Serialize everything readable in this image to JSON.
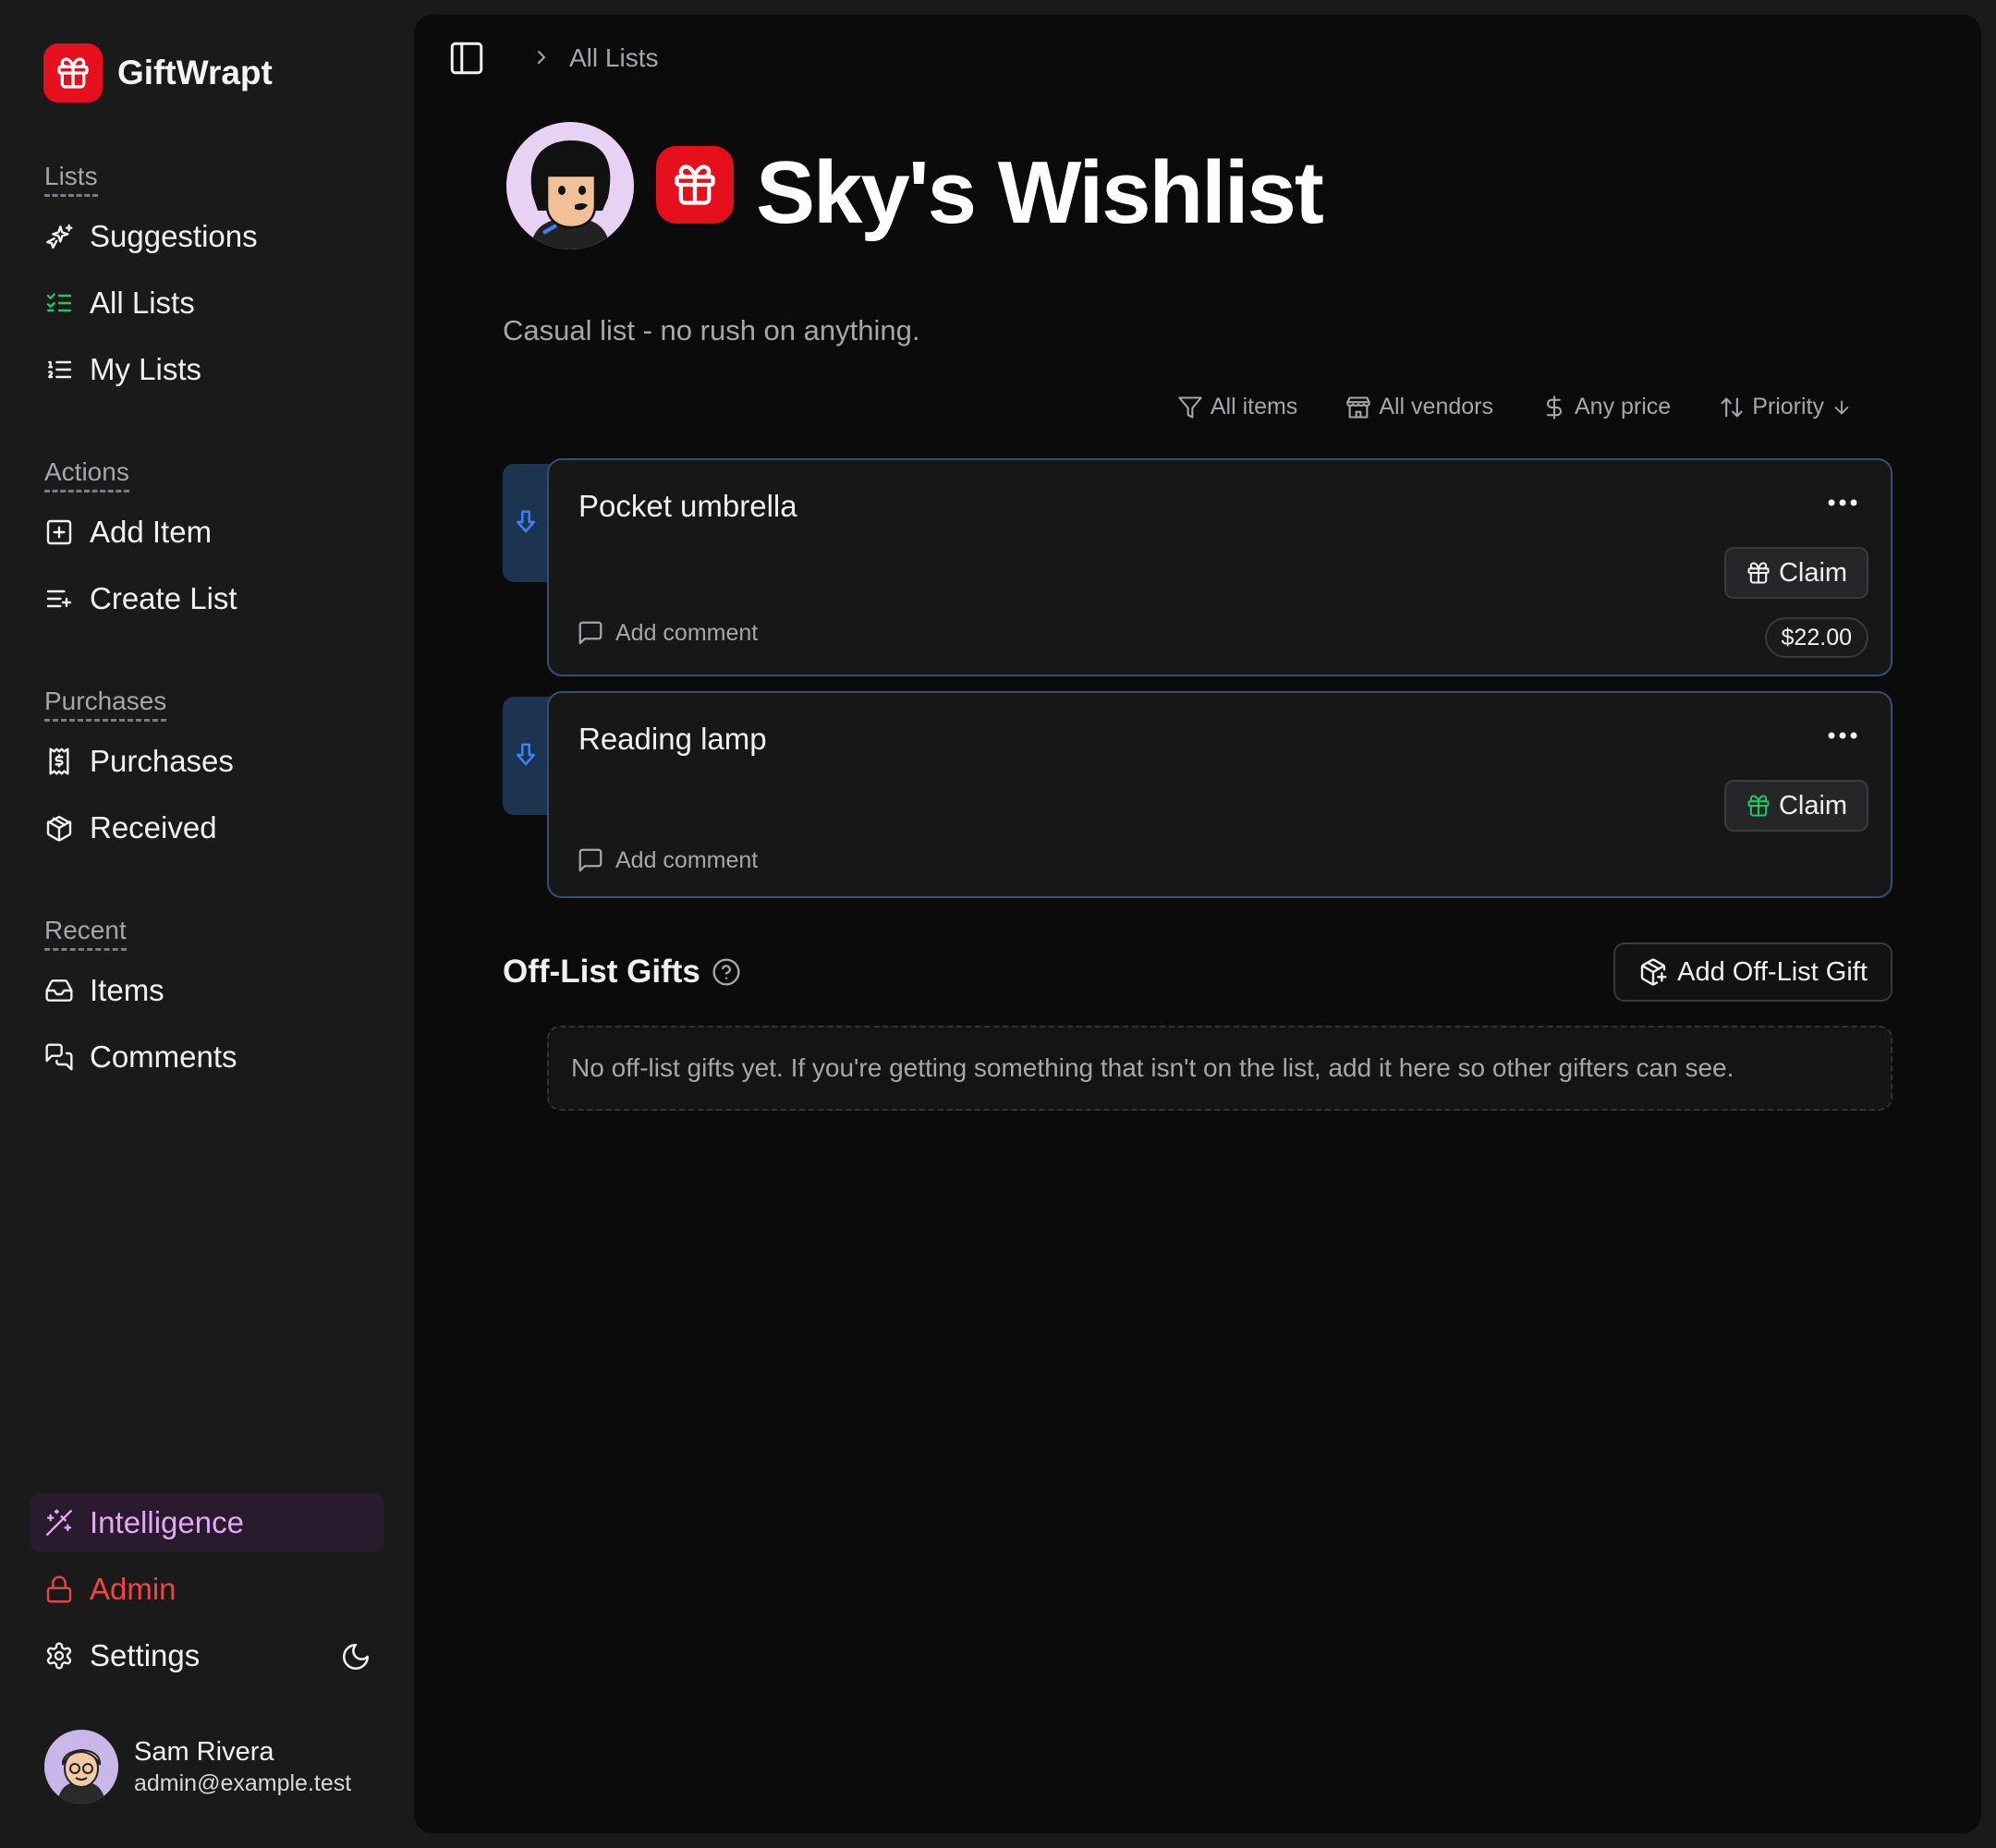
{
  "app": {
    "name": "GiftWrapt"
  },
  "sidebar": {
    "sections": {
      "lists": "Lists",
      "actions": "Actions",
      "purchases": "Purchases",
      "recent": "Recent"
    },
    "items": {
      "suggestions": "Suggestions",
      "all_lists": "All Lists",
      "my_lists": "My Lists",
      "add_item": "Add Item",
      "create_list": "Create List",
      "purchases": "Purchases",
      "received": "Received",
      "recent_items": "Items",
      "comments": "Comments",
      "intelligence": "Intelligence",
      "admin": "Admin",
      "settings": "Settings"
    },
    "user": {
      "name": "Sam Rivera",
      "email": "admin@example.test"
    },
    "colors": {
      "brand": "#e5101c",
      "intelligence": "#e3a8f2",
      "admin": "#ef4444",
      "all_lists_icon": "#22c55e"
    }
  },
  "header": {
    "breadcrumb": "All Lists"
  },
  "list": {
    "title": "Sky's Wishlist",
    "description": "Casual list - no rush on anything."
  },
  "filters": {
    "items": "All items",
    "vendors": "All vendors",
    "price": "Any price",
    "sort": "Priority"
  },
  "items": [
    {
      "title": "Pocket umbrella",
      "claim_label": "Claim",
      "price": "$22.00",
      "comment_label": "Add comment"
    },
    {
      "title": "Reading lamp",
      "claim_label": "Claim",
      "comment_label": "Add comment"
    }
  ],
  "off_list": {
    "title": "Off-List Gifts",
    "add_label": "Add Off-List Gift",
    "empty_text": "No off-list gifts yet. If you're getting something that isn't on the list, add it here so other gifters can see."
  },
  "icons": {
    "brand": "gift-icon",
    "suggestions": "sparkles-icon",
    "all_lists": "list-checks-icon",
    "my_lists": "list-ordered-icon",
    "add_item": "square-plus-icon",
    "create_list": "list-plus-icon",
    "purchases": "receipt-icon",
    "received": "package-open-icon",
    "items": "inbox-icon",
    "comments": "messages-icon",
    "intelligence": "magic-wand-icon",
    "admin": "lock-icon",
    "settings": "gear-icon",
    "theme": "moon-icon",
    "sidebar_toggle": "panel-left-icon",
    "filter": "funnel-icon",
    "vendor": "store-icon",
    "price": "dollar-icon",
    "sort": "arrow-up-down-icon",
    "priority": "arrow-down-icon",
    "more": "ellipsis-icon",
    "comment": "message-square-icon",
    "help": "help-circle-icon",
    "add_offlist": "package-plus-icon"
  }
}
